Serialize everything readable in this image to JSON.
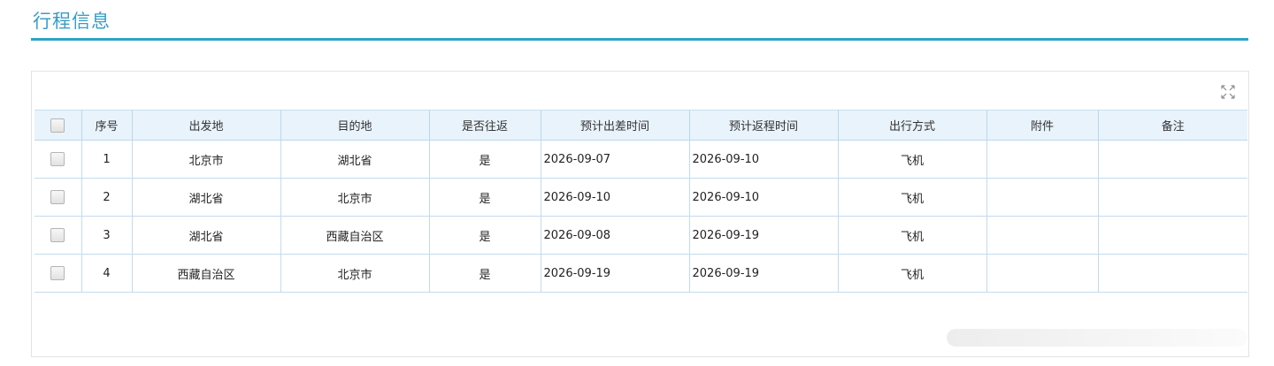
{
  "section": {
    "title": "行程信息"
  },
  "toolbar": {
    "expand_icon": "expand-icon"
  },
  "table": {
    "headers": [
      "序号",
      "出发地",
      "目的地",
      "是否往返",
      "预计出差时间",
      "预计返程时间",
      "出行方式",
      "附件",
      "备注"
    ],
    "rows": [
      {
        "index": "1",
        "from": "北京市",
        "to": "湖北省",
        "round_trip": "是",
        "depart": "2026-09-07",
        "return": "2026-09-10",
        "transport": "飞机",
        "attachment": "",
        "remark": ""
      },
      {
        "index": "2",
        "from": "湖北省",
        "to": "北京市",
        "round_trip": "是",
        "depart": "2026-09-10",
        "return": "2026-09-10",
        "transport": "飞机",
        "attachment": "",
        "remark": ""
      },
      {
        "index": "3",
        "from": "湖北省",
        "to": "西藏自治区",
        "round_trip": "是",
        "depart": "2026-09-08",
        "return": "2026-09-19",
        "transport": "飞机",
        "attachment": "",
        "remark": ""
      },
      {
        "index": "4",
        "from": "西藏自治区",
        "to": "北京市",
        "round_trip": "是",
        "depart": "2026-09-19",
        "return": "2026-09-19",
        "transport": "飞机",
        "attachment": "",
        "remark": ""
      }
    ]
  },
  "colors": {
    "accent": "#2fa3c8",
    "title": "#3a9dc6",
    "header_bg": "#e8f3fb",
    "grid_line": "#c4daee"
  }
}
